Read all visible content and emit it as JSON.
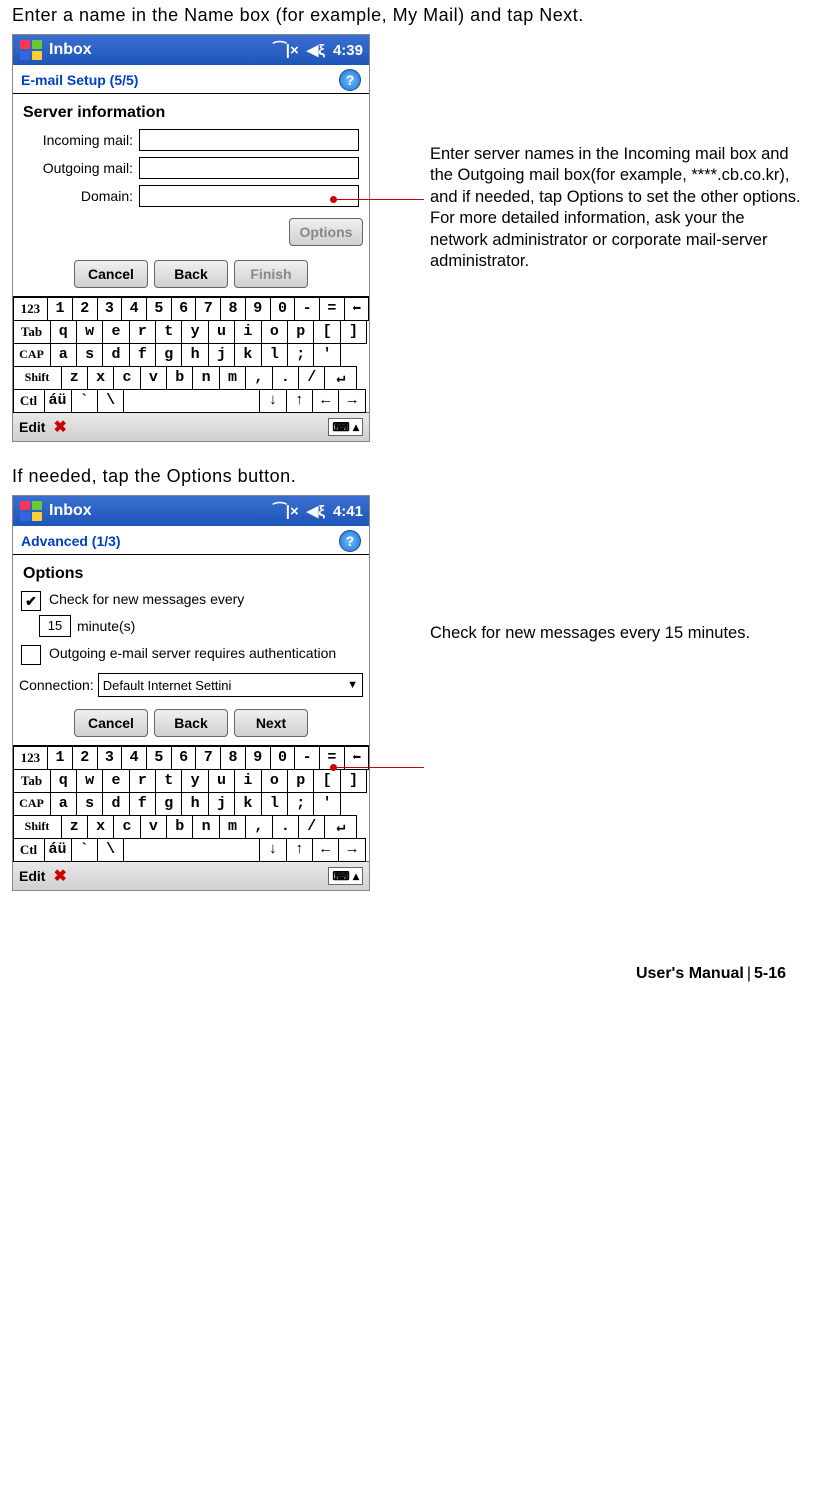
{
  "instruction1": "Enter a name in the Name box (for example, My Mail) and tap Next.",
  "instruction2": "If needed, tap the Options button.",
  "screen1": {
    "titlebar": {
      "title": "Inbox",
      "time": "4:39"
    },
    "subheader": "E-mail Setup (5/5)",
    "section": "Server information",
    "labels": {
      "incoming": "Incoming mail:",
      "outgoing": "Outgoing mail:",
      "domain": "Domain:"
    },
    "buttons": {
      "options": "Options",
      "cancel": "Cancel",
      "back": "Back",
      "finish": "Finish"
    },
    "editbar": "Edit"
  },
  "callout1": "Enter server names in the Incoming mail box and the Outgoing mail box(for example, ****.cb.co.kr), and if needed, tap Options to set the other options. For more detailed information, ask your the network administrator or corporate mail-server administrator.",
  "screen2": {
    "titlebar": {
      "title": "Inbox",
      "time": "4:41"
    },
    "subheader": "Advanced (1/3)",
    "section": "Options",
    "check_new": "Check for new messages every",
    "check_new_value": "15",
    "check_new_unit": "minute(s)",
    "outgoing_auth": "Outgoing e-mail server requires authentication",
    "connection_label": "Connection:",
    "connection_value": "Default Internet Settini",
    "buttons": {
      "cancel": "Cancel",
      "back": "Back",
      "next": "Next"
    },
    "editbar": "Edit"
  },
  "callout2": "Check for new messages every 15 minutes.",
  "keyboard": {
    "r1_lead": "123",
    "r1": [
      "1",
      "2",
      "3",
      "4",
      "5",
      "6",
      "7",
      "8",
      "9",
      "0",
      "-",
      "="
    ],
    "r2_lead": "Tab",
    "r2": [
      "q",
      "w",
      "e",
      "r",
      "t",
      "y",
      "u",
      "i",
      "o",
      "p",
      "[",
      "]"
    ],
    "r3_lead": "CAP",
    "r3": [
      "a",
      "s",
      "d",
      "f",
      "g",
      "h",
      "j",
      "k",
      "l",
      ";",
      "'"
    ],
    "r4_lead": "Shift",
    "r4": [
      "z",
      "x",
      "c",
      "v",
      "b",
      "n",
      "m",
      ",",
      ".",
      "/"
    ],
    "r5_lead": "Ctl",
    "r5_au": "áü"
  },
  "footer": {
    "label": "User's Manual",
    "page": "5-16"
  }
}
